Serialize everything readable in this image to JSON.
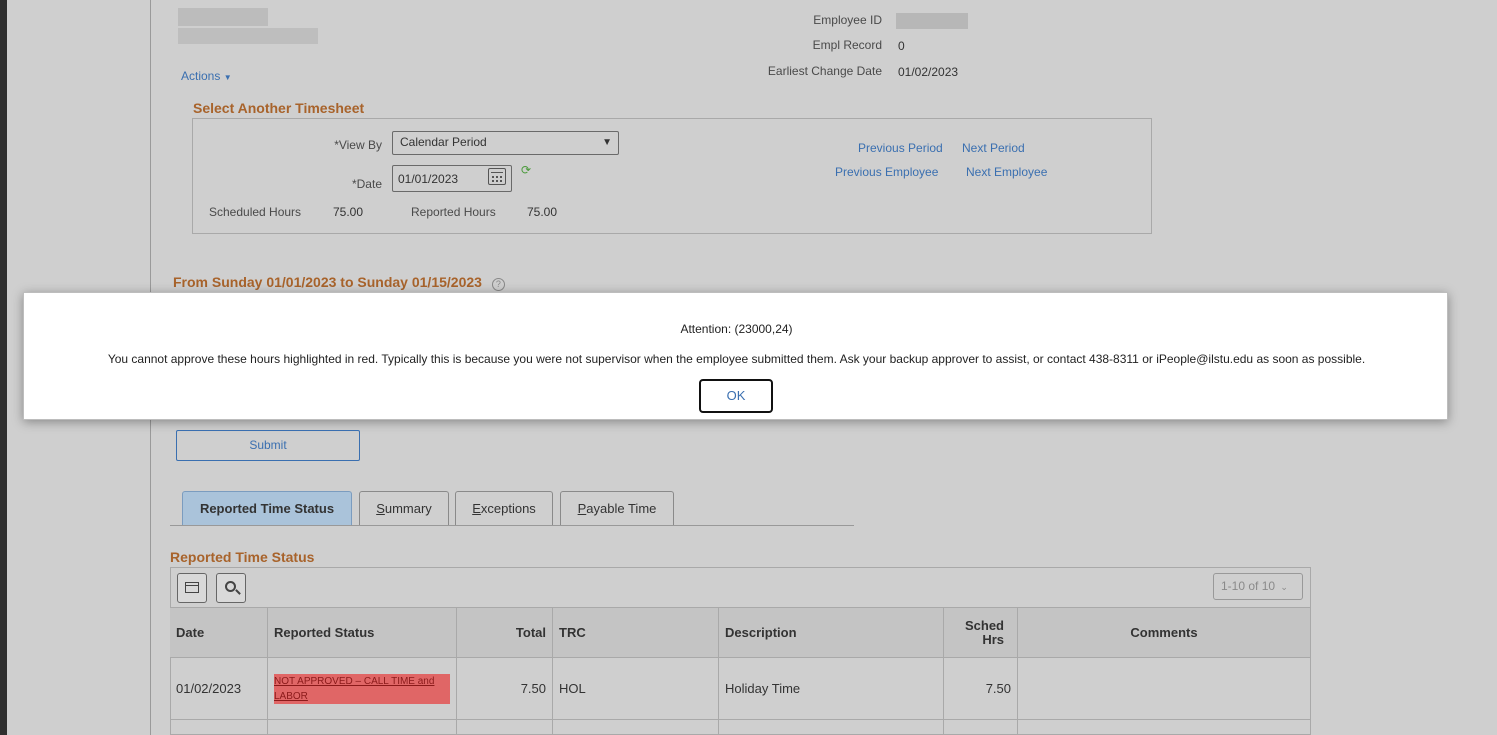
{
  "header": {
    "actions_label": "Actions",
    "employee_id_label": "Employee ID",
    "empl_record_label": "Empl Record",
    "empl_record_value": "0",
    "earliest_change_label": "Earliest Change Date",
    "earliest_change_value": "01/02/2023"
  },
  "select_timesheet": {
    "title": "Select Another Timesheet",
    "view_by_label": "*View By",
    "view_by_value": "Calendar Period",
    "date_label": "*Date",
    "date_value": "01/01/2023",
    "scheduled_hours_label": "Scheduled Hours",
    "scheduled_hours_value": "75.00",
    "reported_hours_label": "Reported Hours",
    "reported_hours_value": "75.00",
    "previous_period": "Previous Period",
    "next_period": "Next Period",
    "previous_employee": "Previous Employee",
    "next_employee": "Next Employee"
  },
  "period_title": "From Sunday 01/01/2023 to Sunday 01/15/2023",
  "modal": {
    "title": "Attention: (23000,24)",
    "message": "You cannot approve these hours highlighted in red.  Typically this is because you were not supervisor when the employee submitted them.  Ask your backup approver to assist, or contact 438-8311 or iPeople@ilstu.edu as soon as possible.",
    "ok_label": "OK"
  },
  "submit_label": "Submit",
  "tabs": [
    {
      "label": "Reported Time Status",
      "active": true
    },
    {
      "label": "Summary",
      "underline": "S"
    },
    {
      "label": "Exceptions",
      "underline": "E"
    },
    {
      "label": "Payable Time",
      "underline": "P"
    }
  ],
  "grid": {
    "title": "Reported Time Status",
    "pager": "1-10 of 10",
    "columns": [
      "Date",
      "Reported Status",
      "Total",
      "TRC",
      "Description",
      "Sched Hrs",
      "Comments"
    ],
    "sched_hrs_line1": "Sched",
    "sched_hrs_line2": "Hrs",
    "rows": [
      {
        "date": "01/02/2023",
        "status": "NOT APPROVED – CALL TIME and LABOR",
        "total": "7.50",
        "trc": "HOL",
        "description": "Holiday Time",
        "sched_hrs": "7.50",
        "comments": ""
      }
    ]
  },
  "colors": {
    "accent": "#a8632b",
    "link": "#3a6fb0",
    "not_approved": "#e06666"
  }
}
